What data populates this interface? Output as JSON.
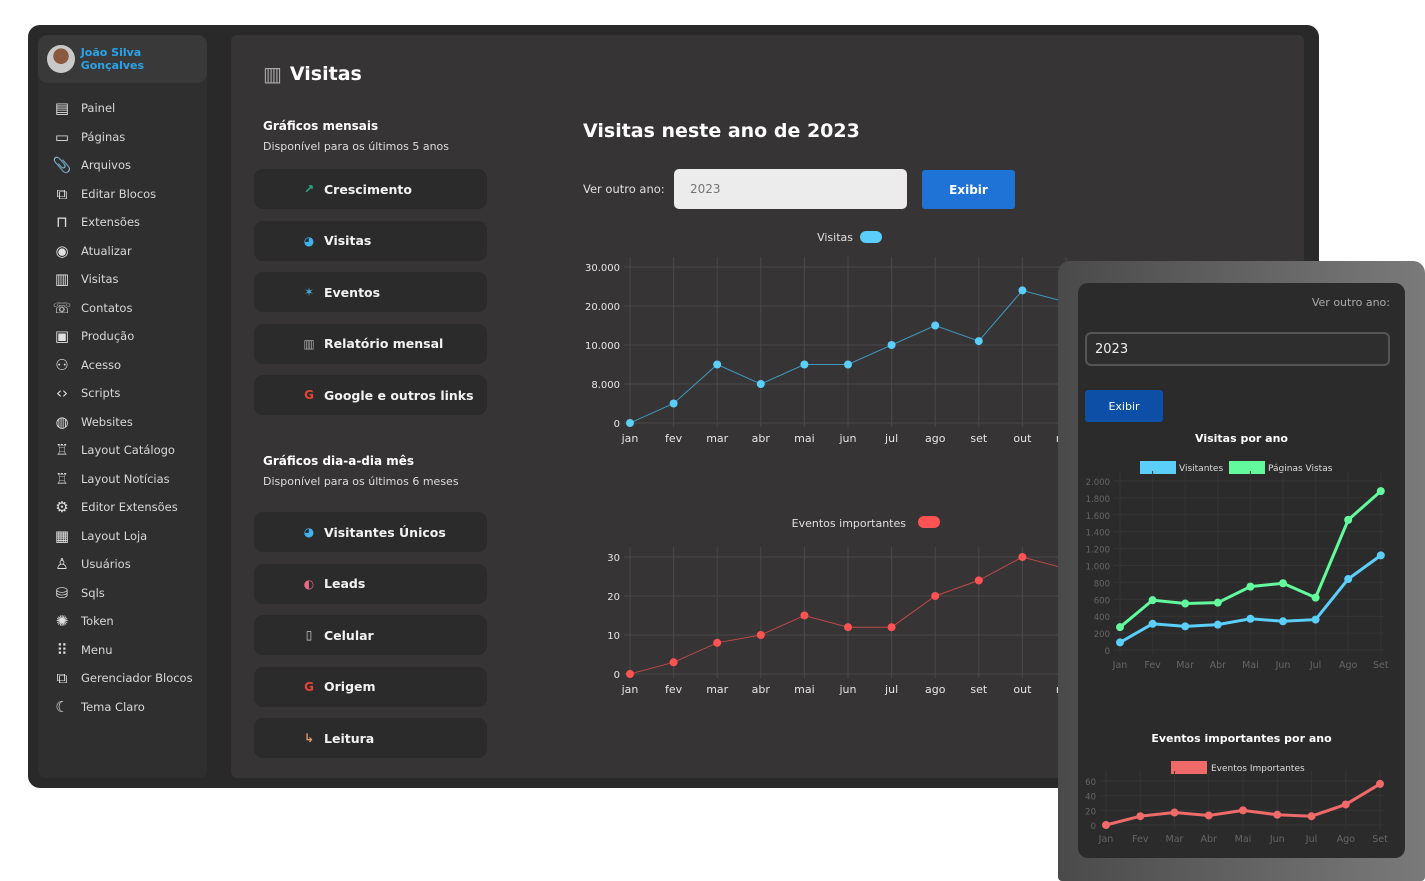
{
  "user": {
    "name": "João Silva Gonçalves"
  },
  "sidebar": {
    "items": [
      {
        "label": "Painel",
        "icon": "dashboard-icon",
        "glyph": "▤"
      },
      {
        "label": "Páginas",
        "icon": "page-icon",
        "glyph": "▭"
      },
      {
        "label": "Arquivos",
        "icon": "paperclip-icon",
        "glyph": "📎"
      },
      {
        "label": "Editar Blocos",
        "icon": "blocks-icon",
        "glyph": "⧉"
      },
      {
        "label": "Extensões",
        "icon": "extension-icon",
        "glyph": "⊓"
      },
      {
        "label": "Atualizar",
        "icon": "update-icon",
        "glyph": "◉"
      },
      {
        "label": "Visitas",
        "icon": "chart-icon",
        "glyph": "▥"
      },
      {
        "label": "Contatos",
        "icon": "contacts-icon",
        "glyph": "☏"
      },
      {
        "label": "Produção",
        "icon": "production-icon",
        "glyph": "▣"
      },
      {
        "label": "Acesso",
        "icon": "users-icon",
        "glyph": "⚇"
      },
      {
        "label": "Scripts",
        "icon": "code-icon",
        "glyph": "‹›"
      },
      {
        "label": "Websites",
        "icon": "globe-icon",
        "glyph": "◍"
      },
      {
        "label": "Layout Catálogo",
        "icon": "layout-icon",
        "glyph": "♖"
      },
      {
        "label": "Layout Notícias",
        "icon": "news-icon",
        "glyph": "♖"
      },
      {
        "label": "Editor Extensões",
        "icon": "extension-editor-icon",
        "glyph": "⚙"
      },
      {
        "label": "Layout Loja",
        "icon": "store-icon",
        "glyph": "▦"
      },
      {
        "label": "Usuários",
        "icon": "user-icon",
        "glyph": "♙"
      },
      {
        "label": "Sqls",
        "icon": "database-icon",
        "glyph": "⛁"
      },
      {
        "label": "Token",
        "icon": "token-icon",
        "glyph": "✺"
      },
      {
        "label": "Menu",
        "icon": "grid-icon",
        "glyph": "⠿"
      },
      {
        "label": "Gerenciador Blocos",
        "icon": "block-manager-icon",
        "glyph": "⧉"
      },
      {
        "label": "Tema Claro",
        "icon": "moon-icon",
        "glyph": "☾"
      }
    ]
  },
  "page": {
    "title": "Visitas"
  },
  "monthly": {
    "title": "Gráficos mensais",
    "subtitle": "Disponível para os últimos 5 anos",
    "buttons": [
      {
        "label": "Crescimento",
        "icon": "trend-up-icon",
        "glyph": "↗",
        "color": "#1fb58c"
      },
      {
        "label": "Visitas",
        "icon": "visitor-icon",
        "glyph": "◕",
        "color": "#3fb2f0"
      },
      {
        "label": "Eventos",
        "icon": "events-icon",
        "glyph": "✶",
        "color": "#4aa8d8"
      },
      {
        "label": "Relatório mensal",
        "icon": "report-icon",
        "glyph": "▥",
        "color": "#aaa"
      },
      {
        "label": "Google e outros links",
        "icon": "google-icon",
        "glyph": "G",
        "color": "#ea4335"
      }
    ]
  },
  "daily": {
    "title": "Gráficos dia-a-dia mês",
    "subtitle": "Disponível para os últimos 6 meses",
    "buttons": [
      {
        "label": "Visitantes Únicos",
        "icon": "visitor-icon",
        "glyph": "◕",
        "color": "#3fb2f0"
      },
      {
        "label": "Leads",
        "icon": "leads-icon",
        "glyph": "◐",
        "color": "#e86a8a"
      },
      {
        "label": "Celular",
        "icon": "mobile-icon",
        "glyph": "▯",
        "color": "#ccc"
      },
      {
        "label": "Origem",
        "icon": "google-icon",
        "glyph": "G",
        "color": "#ea4335"
      },
      {
        "label": "Leitura",
        "icon": "reading-icon",
        "glyph": "↳",
        "color": "#e0956a"
      }
    ]
  },
  "year_panel": {
    "title": "Visitas neste ano de 2023",
    "label": "Ver outro ano:",
    "input_placeholder": "2023",
    "button": "Exibir"
  },
  "mobile": {
    "label": "Ver outro ano:",
    "input_value": "2023",
    "button": "Exibir"
  },
  "chart_data": [
    {
      "type": "line",
      "title": "",
      "legend": "Visitas",
      "color": "#5bcefa",
      "categories": [
        "jan",
        "fev",
        "mar",
        "abr",
        "mai",
        "jun",
        "jul",
        "ago",
        "set",
        "out",
        "nov"
      ],
      "values": [
        0,
        4000,
        9000,
        8000,
        9000,
        9000,
        10000,
        15000,
        11000,
        24000,
        21000
      ],
      "yticks": [
        0,
        8000,
        10000,
        20000,
        30000
      ],
      "ytick_labels": [
        "0",
        "8.000",
        "10.000",
        "20.000",
        "30.000"
      ],
      "grid": true,
      "legend_position": "top"
    },
    {
      "type": "line",
      "title": "",
      "legend": "Eventos importantes",
      "color": "#ff5252",
      "categories": [
        "jan",
        "fev",
        "mar",
        "abr",
        "mai",
        "jun",
        "jul",
        "ago",
        "set",
        "out",
        "nov"
      ],
      "values": [
        0,
        3,
        8,
        10,
        15,
        12,
        12,
        20,
        24,
        30,
        27
      ],
      "yticks": [
        0,
        10,
        20,
        30
      ],
      "ytick_labels": [
        "0",
        "10",
        "20",
        "30"
      ],
      "grid": true,
      "legend_position": "top"
    },
    {
      "type": "line",
      "title": "Visitas por ano",
      "categories": [
        "Jan",
        "Fev",
        "Mar",
        "Abr",
        "Mai",
        "Jun",
        "Jul",
        "Ago",
        "Set"
      ],
      "series": [
        {
          "name": "Visitantes",
          "color": "#5bcefa",
          "values": [
            90,
            310,
            280,
            300,
            370,
            340,
            360,
            840,
            1120
          ]
        },
        {
          "name": "Páginas Vistas",
          "color": "#62fa9c",
          "values": [
            270,
            590,
            550,
            560,
            750,
            790,
            620,
            1540,
            1880
          ]
        }
      ],
      "yticks": [
        0,
        200,
        400,
        600,
        800,
        1000,
        1200,
        1400,
        1600,
        1800,
        2000
      ],
      "ytick_labels": [
        "0",
        "200",
        "400",
        "600",
        "800",
        "1.000",
        "1.200",
        "1.400",
        "1.600",
        "1.800",
        "2.000"
      ],
      "ylim": [
        0,
        2000
      ],
      "legend_position": "top"
    },
    {
      "type": "line",
      "title": "Eventos importantes por ano",
      "categories": [
        "Jan",
        "Fev",
        "Mar",
        "Abr",
        "Mai",
        "Jun",
        "Jul",
        "Ago",
        "Set"
      ],
      "series": [
        {
          "name": "Eventos Importantes",
          "color": "#f06a6a",
          "values": [
            0,
            12,
            17,
            13,
            20,
            14,
            12,
            28,
            56
          ]
        }
      ],
      "yticks": [
        0,
        20,
        40,
        60
      ],
      "ytick_labels": [
        "0",
        "20",
        "40",
        "60"
      ],
      "ylim": [
        0,
        60
      ],
      "legend_position": "top"
    }
  ]
}
